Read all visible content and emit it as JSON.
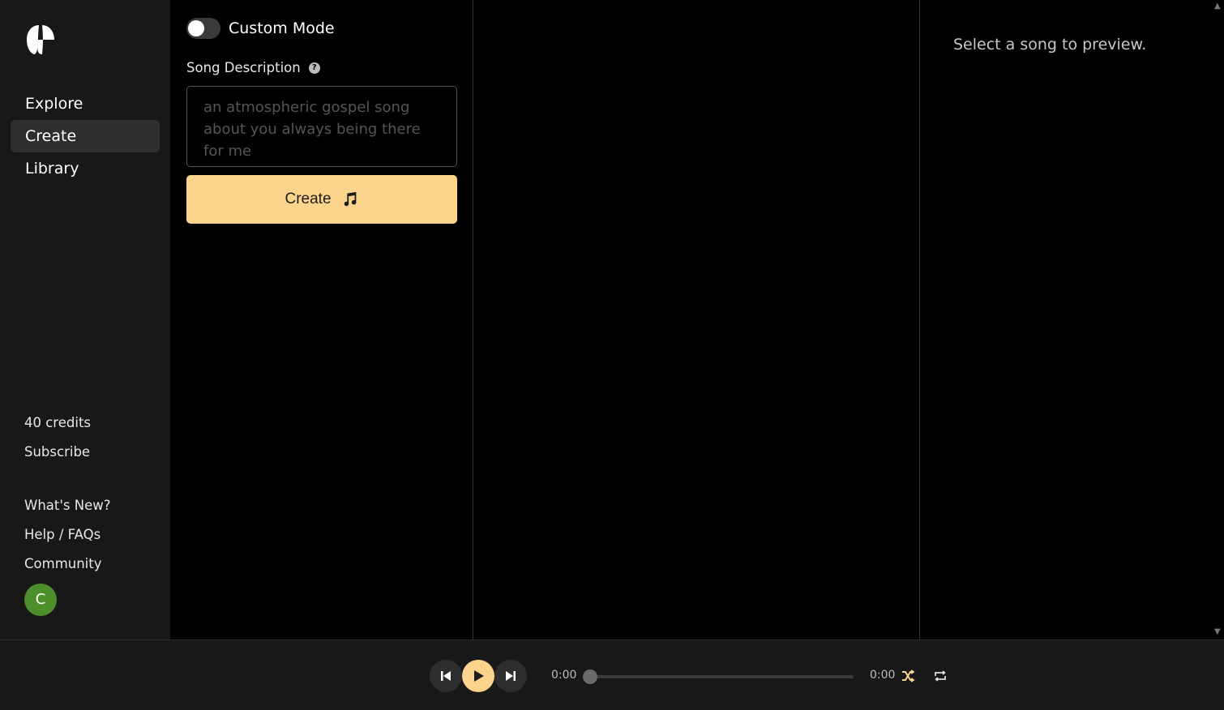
{
  "sidebar": {
    "logo_icon": "suno-wave-logo",
    "nav": [
      {
        "label": "Explore",
        "active": false
      },
      {
        "label": "Create",
        "active": true
      },
      {
        "label": "Library",
        "active": false
      }
    ],
    "credits": "40 credits",
    "subscribe": "Subscribe",
    "whats_new": "What's New?",
    "help": "Help / FAQs",
    "community": "Community",
    "avatar_initial": "C"
  },
  "create": {
    "custom_mode_label": "Custom Mode",
    "custom_mode_on": false,
    "description_label": "Song Description",
    "description_placeholder": "an atmospheric gospel song about you always being there for me",
    "description_value": "",
    "create_label": "Create"
  },
  "preview": {
    "empty_text": "Select a song to preview."
  },
  "player": {
    "current_time": "0:00",
    "duration": "0:00",
    "progress": 0
  },
  "colors": {
    "accent": "#fcd48c",
    "sidebar_bg": "#181818",
    "avatar_bg": "#4d8f2a"
  }
}
